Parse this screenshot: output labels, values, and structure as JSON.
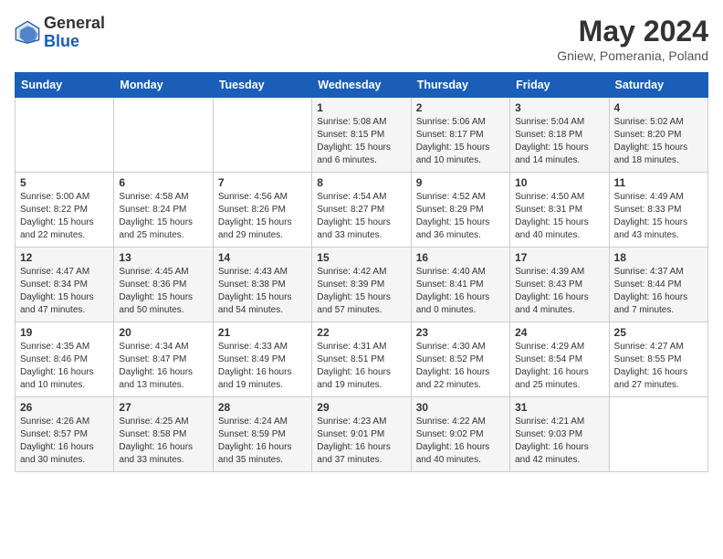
{
  "header": {
    "logo_general": "General",
    "logo_blue": "Blue",
    "title": "May 2024",
    "location": "Gniew, Pomerania, Poland"
  },
  "days_of_week": [
    "Sunday",
    "Monday",
    "Tuesday",
    "Wednesday",
    "Thursday",
    "Friday",
    "Saturday"
  ],
  "weeks": [
    [
      {
        "day": "",
        "content": ""
      },
      {
        "day": "",
        "content": ""
      },
      {
        "day": "",
        "content": ""
      },
      {
        "day": "1",
        "content": "Sunrise: 5:08 AM\nSunset: 8:15 PM\nDaylight: 15 hours\nand 6 minutes."
      },
      {
        "day": "2",
        "content": "Sunrise: 5:06 AM\nSunset: 8:17 PM\nDaylight: 15 hours\nand 10 minutes."
      },
      {
        "day": "3",
        "content": "Sunrise: 5:04 AM\nSunset: 8:18 PM\nDaylight: 15 hours\nand 14 minutes."
      },
      {
        "day": "4",
        "content": "Sunrise: 5:02 AM\nSunset: 8:20 PM\nDaylight: 15 hours\nand 18 minutes."
      }
    ],
    [
      {
        "day": "5",
        "content": "Sunrise: 5:00 AM\nSunset: 8:22 PM\nDaylight: 15 hours\nand 22 minutes."
      },
      {
        "day": "6",
        "content": "Sunrise: 4:58 AM\nSunset: 8:24 PM\nDaylight: 15 hours\nand 25 minutes."
      },
      {
        "day": "7",
        "content": "Sunrise: 4:56 AM\nSunset: 8:26 PM\nDaylight: 15 hours\nand 29 minutes."
      },
      {
        "day": "8",
        "content": "Sunrise: 4:54 AM\nSunset: 8:27 PM\nDaylight: 15 hours\nand 33 minutes."
      },
      {
        "day": "9",
        "content": "Sunrise: 4:52 AM\nSunset: 8:29 PM\nDaylight: 15 hours\nand 36 minutes."
      },
      {
        "day": "10",
        "content": "Sunrise: 4:50 AM\nSunset: 8:31 PM\nDaylight: 15 hours\nand 40 minutes."
      },
      {
        "day": "11",
        "content": "Sunrise: 4:49 AM\nSunset: 8:33 PM\nDaylight: 15 hours\nand 43 minutes."
      }
    ],
    [
      {
        "day": "12",
        "content": "Sunrise: 4:47 AM\nSunset: 8:34 PM\nDaylight: 15 hours\nand 47 minutes."
      },
      {
        "day": "13",
        "content": "Sunrise: 4:45 AM\nSunset: 8:36 PM\nDaylight: 15 hours\nand 50 minutes."
      },
      {
        "day": "14",
        "content": "Sunrise: 4:43 AM\nSunset: 8:38 PM\nDaylight: 15 hours\nand 54 minutes."
      },
      {
        "day": "15",
        "content": "Sunrise: 4:42 AM\nSunset: 8:39 PM\nDaylight: 15 hours\nand 57 minutes."
      },
      {
        "day": "16",
        "content": "Sunrise: 4:40 AM\nSunset: 8:41 PM\nDaylight: 16 hours\nand 0 minutes."
      },
      {
        "day": "17",
        "content": "Sunrise: 4:39 AM\nSunset: 8:43 PM\nDaylight: 16 hours\nand 4 minutes."
      },
      {
        "day": "18",
        "content": "Sunrise: 4:37 AM\nSunset: 8:44 PM\nDaylight: 16 hours\nand 7 minutes."
      }
    ],
    [
      {
        "day": "19",
        "content": "Sunrise: 4:35 AM\nSunset: 8:46 PM\nDaylight: 16 hours\nand 10 minutes."
      },
      {
        "day": "20",
        "content": "Sunrise: 4:34 AM\nSunset: 8:47 PM\nDaylight: 16 hours\nand 13 minutes."
      },
      {
        "day": "21",
        "content": "Sunrise: 4:33 AM\nSunset: 8:49 PM\nDaylight: 16 hours\nand 19 minutes."
      },
      {
        "day": "22",
        "content": "Sunrise: 4:31 AM\nSunset: 8:51 PM\nDaylight: 16 hours\nand 19 minutes."
      },
      {
        "day": "23",
        "content": "Sunrise: 4:30 AM\nSunset: 8:52 PM\nDaylight: 16 hours\nand 22 minutes."
      },
      {
        "day": "24",
        "content": "Sunrise: 4:29 AM\nSunset: 8:54 PM\nDaylight: 16 hours\nand 25 minutes."
      },
      {
        "day": "25",
        "content": "Sunrise: 4:27 AM\nSunset: 8:55 PM\nDaylight: 16 hours\nand 27 minutes."
      }
    ],
    [
      {
        "day": "26",
        "content": "Sunrise: 4:26 AM\nSunset: 8:57 PM\nDaylight: 16 hours\nand 30 minutes."
      },
      {
        "day": "27",
        "content": "Sunrise: 4:25 AM\nSunset: 8:58 PM\nDaylight: 16 hours\nand 33 minutes."
      },
      {
        "day": "28",
        "content": "Sunrise: 4:24 AM\nSunset: 8:59 PM\nDaylight: 16 hours\nand 35 minutes."
      },
      {
        "day": "29",
        "content": "Sunrise: 4:23 AM\nSunset: 9:01 PM\nDaylight: 16 hours\nand 37 minutes."
      },
      {
        "day": "30",
        "content": "Sunrise: 4:22 AM\nSunset: 9:02 PM\nDaylight: 16 hours\nand 40 minutes."
      },
      {
        "day": "31",
        "content": "Sunrise: 4:21 AM\nSunset: 9:03 PM\nDaylight: 16 hours\nand 42 minutes."
      },
      {
        "day": "",
        "content": ""
      }
    ]
  ]
}
